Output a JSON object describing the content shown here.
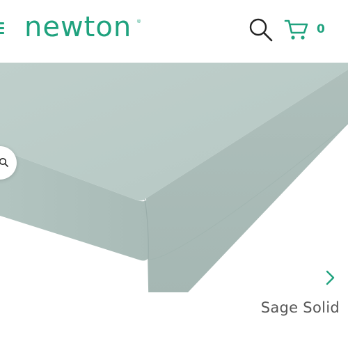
{
  "header": {
    "logo_text": "newton",
    "logo_mark": "®",
    "cart_count": "0",
    "icons": {
      "menu": "hamburger-menu-icon",
      "search": "search-icon",
      "cart": "shopping-cart-icon"
    }
  },
  "product": {
    "image_alt": "Sage fitted crib sheet on mattress",
    "zoom_icon": "zoom-icon",
    "next_icon": "chevron-right-icon",
    "name": "Sage Solid"
  },
  "colors": {
    "brand": "#1fa27e",
    "sheet": "#b9cbc7",
    "text": "#555555"
  }
}
